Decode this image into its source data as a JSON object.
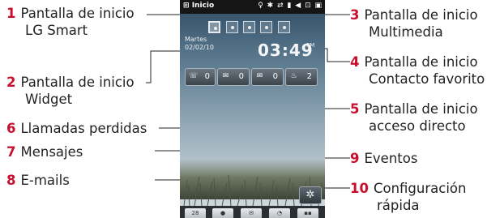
{
  "labels": [
    {
      "num": "1",
      "line1": "Pantalla de inicio",
      "line2": "LG Smart"
    },
    {
      "num": "2",
      "line1": "Pantalla de inicio",
      "line2": "Widget"
    },
    {
      "num": "6",
      "line1": "Llamadas perdidas",
      "line2": ""
    },
    {
      "num": "7",
      "line1": "Mensajes",
      "line2": ""
    },
    {
      "num": "8",
      "line1": "E-mails",
      "line2": ""
    },
    {
      "num": "3",
      "line1": "Pantalla de inicio",
      "line2": "Multimedia"
    },
    {
      "num": "4",
      "line1": "Pantalla de inicio",
      "line2": "Contacto favorito"
    },
    {
      "num": "5",
      "line1": "Pantalla de inicio",
      "line2": "acceso directo"
    },
    {
      "num": "9",
      "line1": "Eventos",
      "line2": ""
    },
    {
      "num": "10",
      "line1": "Configuración",
      "line2": "rápida"
    }
  ],
  "phone": {
    "start_label": "Inicio",
    "date_day": "Martes",
    "date": "02/02/10",
    "clock": "03:49",
    "ampm": "PM",
    "widgets": [
      {
        "icon": "missed-call-icon",
        "count": "0"
      },
      {
        "icon": "message-icon",
        "count": "0"
      },
      {
        "icon": "email-icon",
        "count": "0"
      },
      {
        "icon": "event-icon",
        "count": "2"
      }
    ],
    "dock_first": "28"
  },
  "colors": {
    "number": "#c8102e",
    "text": "#231f20",
    "leader": "#222222"
  }
}
